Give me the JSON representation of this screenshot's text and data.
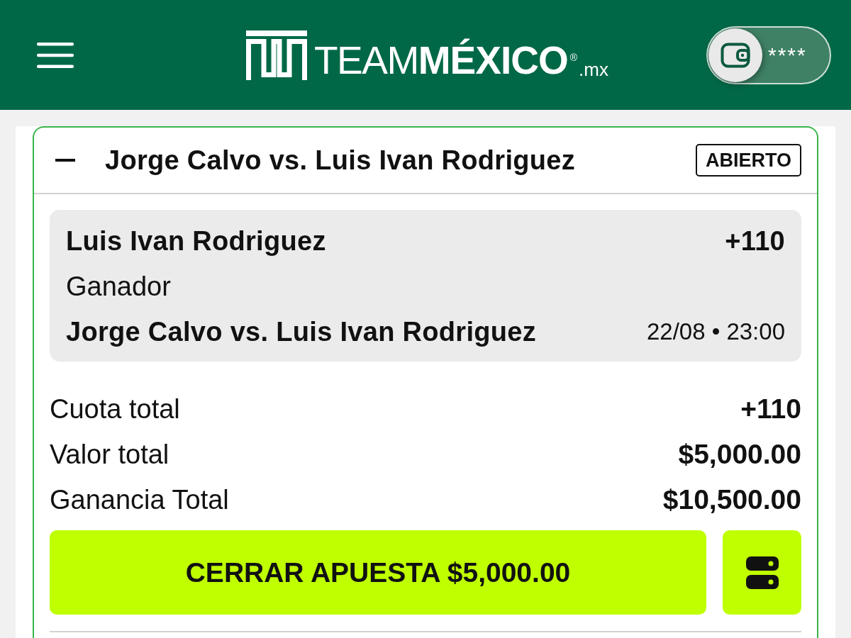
{
  "header": {
    "logo": {
      "wordmark": "TEAM**MÉXICO**$^{®}$",
      "domain": ".mx"
    },
    "wallet": {
      "balance": "****"
    }
  },
  "bet": {
    "expanded": true,
    "title": "Jorge Calvo vs. Luis Ivan Rodriguez",
    "status": "ABIERTO",
    "selection": {
      "pick": "Luis Ivan Rodriguez",
      "odds": "+110",
      "market": "Ganador",
      "event": "Jorge Calvo vs. Luis Ivan Rodriguez",
      "datetime": "22/08 • 23:00"
    },
    "summary": [
      {
        "label": "Cuota total",
        "value": "+110"
      },
      {
        "label": "Valor total",
        "value": "$5,000.00"
      },
      {
        "label": "Ganancia Total",
        "value": "$10,500.00"
      }
    ],
    "cashout_button": "CERRAR APUESTA $5,000.00"
  }
}
